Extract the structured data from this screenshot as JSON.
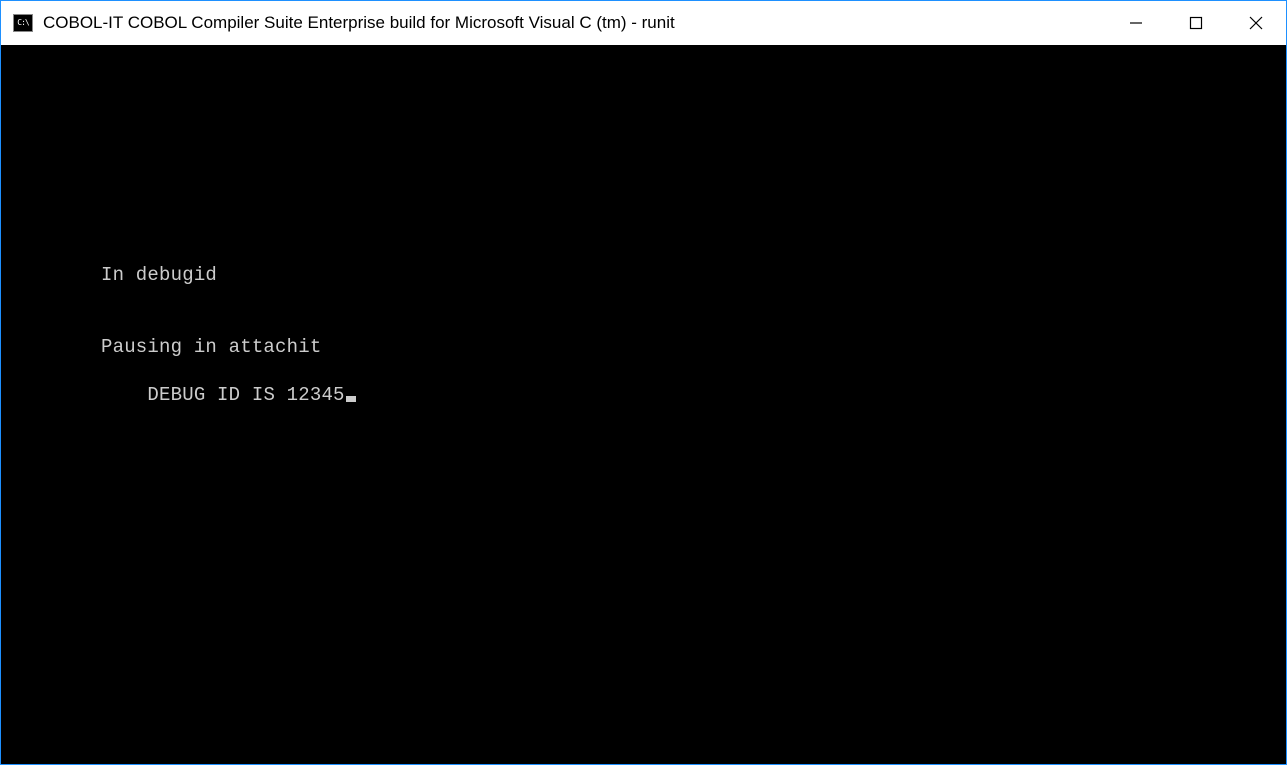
{
  "window": {
    "title": "COBOL-IT COBOL Compiler Suite Enterprise build for Microsoft Visual C (tm) - runit",
    "icon_label": "C:\\"
  },
  "terminal": {
    "lines": [
      "In debugid",
      "Pausing in attachit",
      "DEBUG ID IS 12345"
    ]
  }
}
